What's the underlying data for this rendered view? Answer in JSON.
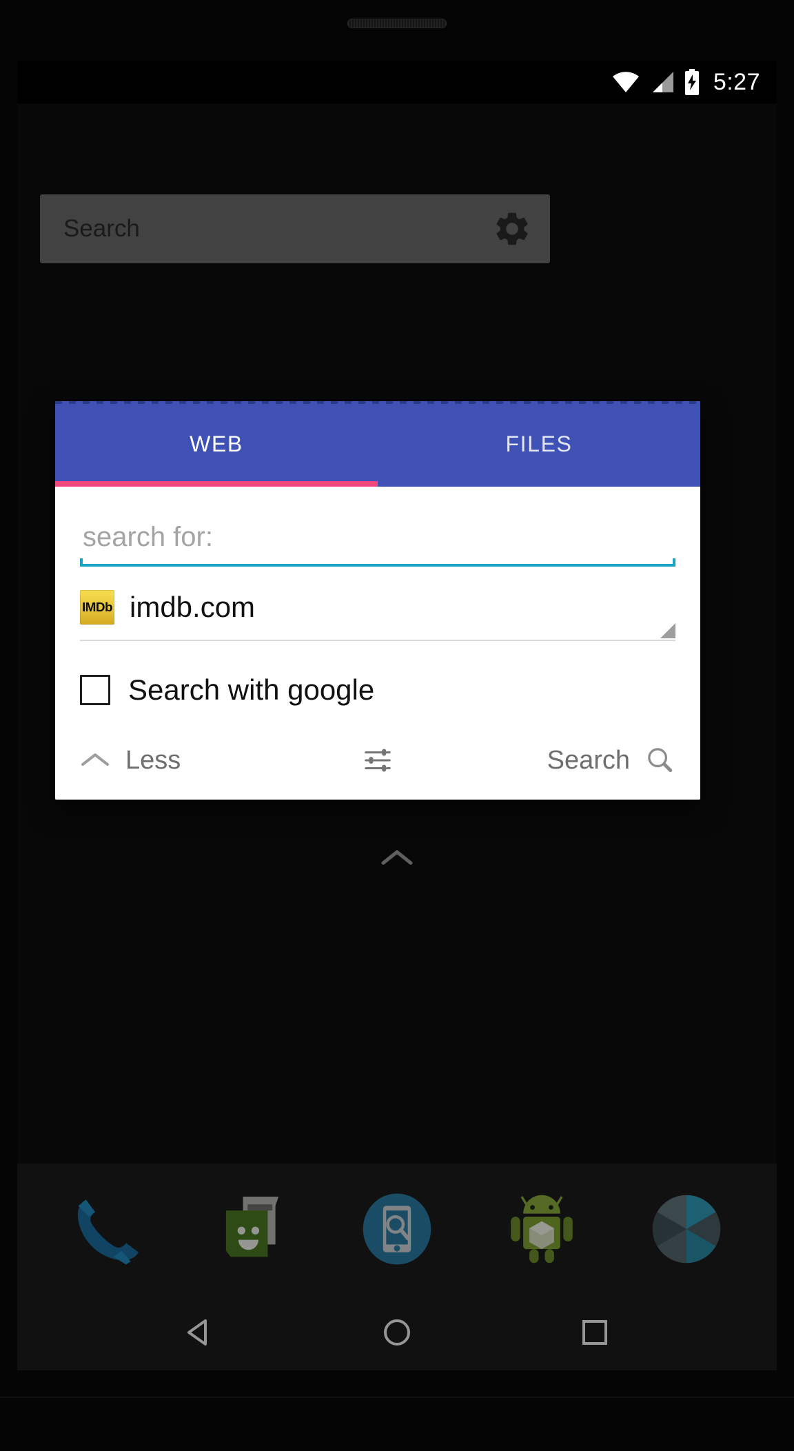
{
  "statusbar": {
    "time": "5:27",
    "icons": [
      "wifi-icon",
      "cell-signal-icon",
      "battery-charging-icon"
    ]
  },
  "homescreen": {
    "search_widget": {
      "placeholder": "Search",
      "settings_icon": "gear-icon"
    },
    "all_apps_arrow_icon": "chevron-up-icon",
    "dock": {
      "items": [
        {
          "name": "phone",
          "icon": "phone-icon"
        },
        {
          "name": "messaging",
          "icon": "messaging-icon"
        },
        {
          "name": "device-search",
          "icon": "device-search-icon"
        },
        {
          "name": "android",
          "icon": "android-robot-icon"
        },
        {
          "name": "camera",
          "icon": "camera-shutter-icon"
        }
      ]
    },
    "navbar": {
      "back_icon": "back-triangle-icon",
      "home_icon": "home-circle-icon",
      "recents_icon": "recents-square-icon"
    }
  },
  "dialog": {
    "tabs": [
      {
        "label": "WEB",
        "active": true
      },
      {
        "label": "FILES",
        "active": false
      }
    ],
    "indicator_color": "#f0487c",
    "tabbar_color": "#3f51b5",
    "search_input": {
      "value": "",
      "placeholder": "search for:",
      "underline_color": "#1aa3c4"
    },
    "engine_spinner": {
      "selected": "imdb.com",
      "icon": "imdb-icon",
      "icon_text": "IMDb",
      "caret_icon": "spinner-caret-icon"
    },
    "google_checkbox": {
      "label": "Search with google",
      "checked": false
    },
    "actions": {
      "less_label": "Less",
      "less_icon": "chevron-up-icon",
      "tune_icon": "tune-sliders-icon",
      "search_label": "Search",
      "search_icon": "magnifier-icon"
    }
  }
}
